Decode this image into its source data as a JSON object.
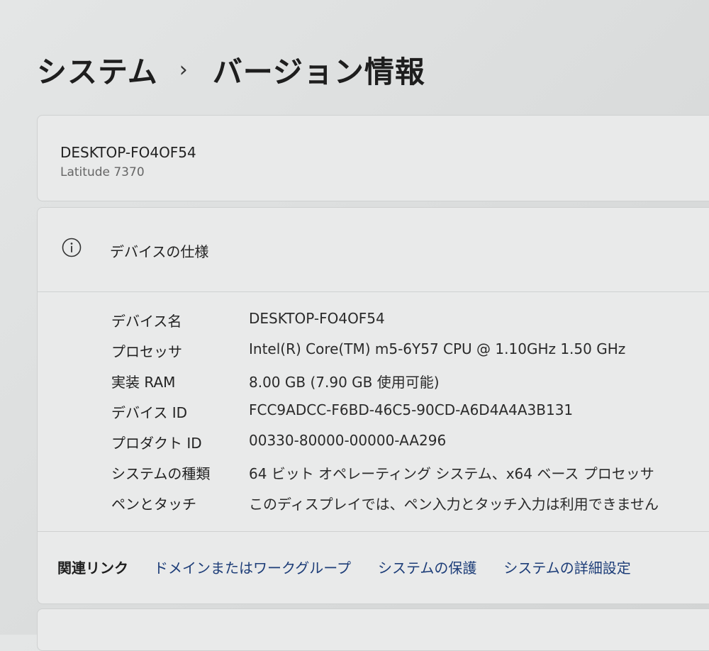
{
  "breadcrumb": {
    "parent": "システム",
    "separator": "›",
    "current": "バージョン情報"
  },
  "device": {
    "name": "DESKTOP-FO4OF54",
    "model": "Latitude 7370"
  },
  "specs": {
    "title": "デバイスの仕様",
    "icon": "info-icon",
    "rows": [
      {
        "label": "デバイス名",
        "value": "DESKTOP-FO4OF54"
      },
      {
        "label": "プロセッサ",
        "value": "Intel(R) Core(TM) m5-6Y57 CPU @ 1.10GHz   1.50 GHz"
      },
      {
        "label": "実装 RAM",
        "value": "8.00 GB (7.90 GB 使用可能)"
      },
      {
        "label": "デバイス ID",
        "value": "FCC9ADCC-F6BD-46C5-90CD-A6D4A4A3B131"
      },
      {
        "label": "プロダクト ID",
        "value": "00330-80000-00000-AA296"
      },
      {
        "label": "システムの種類",
        "value": "64 ビット オペレーティング システム、x64 ベース プロセッサ"
      },
      {
        "label": "ペンとタッチ",
        "value": "このディスプレイでは、ペン入力とタッチ入力は利用できません"
      }
    ]
  },
  "related": {
    "label": "関連リンク",
    "links": [
      "ドメインまたはワークグループ",
      "システムの保護",
      "システムの詳細設定"
    ]
  }
}
